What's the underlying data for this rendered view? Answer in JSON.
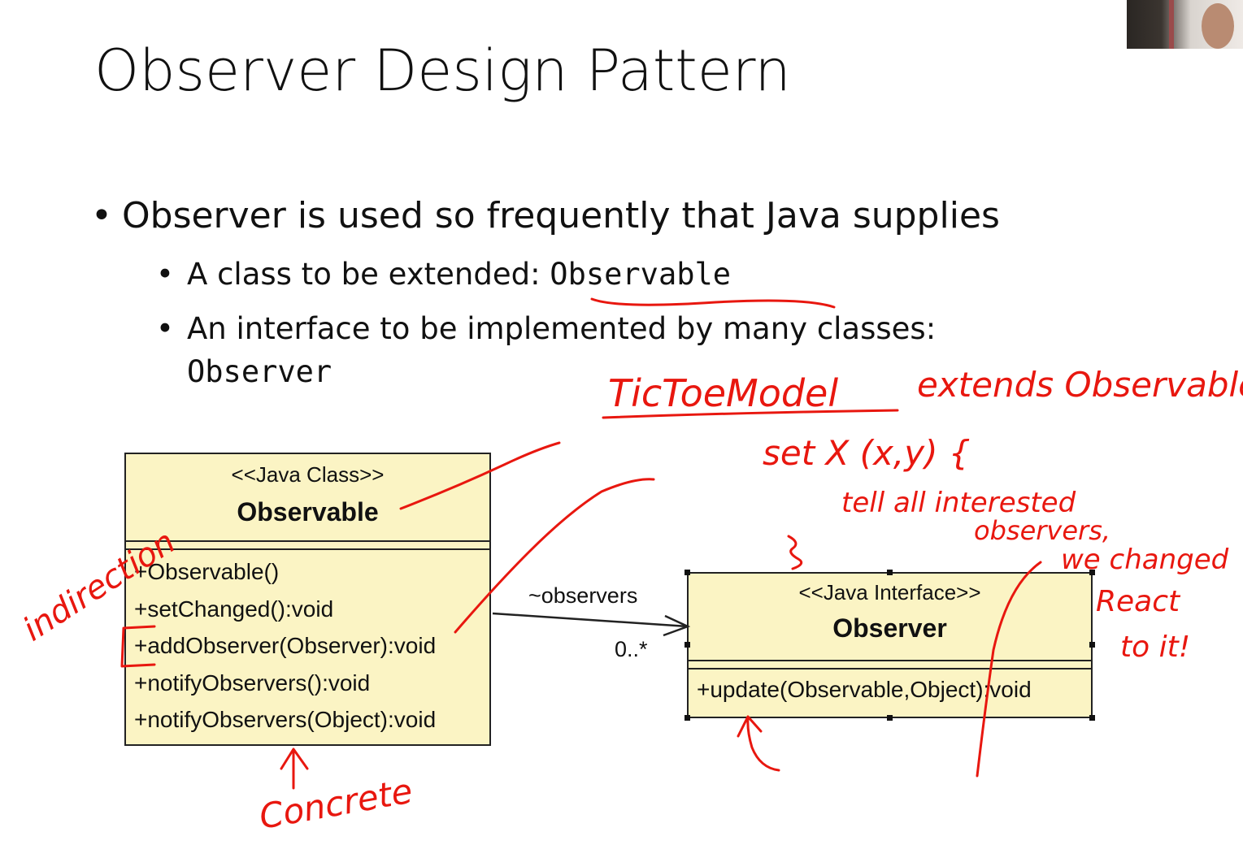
{
  "slide": {
    "title": "Observer Design Pattern",
    "bullet_main": "Observer is used so frequently that Java supplies",
    "sub1_text": "A class to be extended: ",
    "sub1_code": "Observable",
    "sub2_text": "An interface to be implemented by many classes:",
    "sub2_code": "Observer"
  },
  "diagram": {
    "observable": {
      "stereotype": "<<Java Class>>",
      "name": "Observable",
      "operations": [
        "+Observable()",
        "+setChanged():void",
        "+addObserver(Observer):void",
        "+notifyObservers():void",
        "+notifyObservers(Object):void"
      ]
    },
    "observer": {
      "stereotype": "<<Java Interface>>",
      "name": "Observer",
      "operations": [
        "+update(Observable,Object):void"
      ]
    },
    "association": {
      "role": "~observers",
      "multiplicity": "0..*"
    }
  },
  "annotations": {
    "color": "#e8170f",
    "model_class": "TicToeModel",
    "extends_text": "extends Observable",
    "method": "set X (x,y) {",
    "line1": "tell all interested",
    "line2": "observers,",
    "line3": "we changed",
    "line4": "React",
    "line5": "to it!",
    "indirection": "indirection",
    "concrete": "Concrete"
  }
}
